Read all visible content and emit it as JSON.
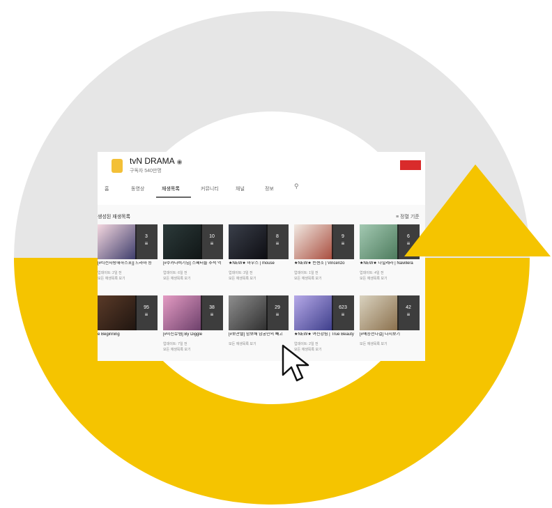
{
  "channel": {
    "name": "tvN DRAMA",
    "verified_icon": "verified-icon",
    "subscribers": "구독자 540만명"
  },
  "tabs": [
    "홈",
    "동영상",
    "재생목록",
    "커뮤니티",
    "채널",
    "정보"
  ],
  "active_tab": "재생목록",
  "section": {
    "title": "생성된 재생목록",
    "sort_label": "정렬 기준"
  },
  "playlists_row1": [
    {
      "title": "[#티전자랑해하스포]] 드라마 등",
      "count": "3",
      "meta": "업데이트: 2일 전",
      "link": "모든 재생목록 보기"
    },
    {
      "title": "[#주카다비기님] 스페터를 추적 역",
      "count": "10",
      "meta": "업데이트: 6일 전",
      "link": "모든 재생목록 보기"
    },
    {
      "title": "★NEW★ 마우스 | mouse",
      "count": "8",
      "meta": "업데이트: 3일 전",
      "link": "모든 재생목록 보기"
    },
    {
      "title": "★NEW★ 빈센조 | Vincenzo",
      "count": "9",
      "meta": "업데이트: 1일 전",
      "link": "모든 재생목록 보기"
    },
    {
      "title": "★NEW★ 나빌레라 | Navillera",
      "count": "6",
      "meta": "업데이트: 4일 전",
      "link": "모든 재생목록 보기"
    }
  ],
  "playlists_row2": [
    {
      "title": "e Beginning",
      "count": "95",
      "meta": "",
      "link": ""
    },
    {
      "title": "[#미신뮤템] By Diggle",
      "count": "38",
      "meta": "업데이트: 7일 전",
      "link": "모든 재생목록 보기"
    },
    {
      "title": "[#보관빨] 밤보배 남궁민의 빼고",
      "count": "29",
      "meta": "모든 재생목록 보기",
      "link": ""
    },
    {
      "title": "★NEW★ 여신강림 | True Beauty",
      "count": "623",
      "meta": "업데이트: 2일 전",
      "link": "모든 재생목록 보기"
    },
    {
      "title": "[#예능선나결] 다시보기",
      "count": "42",
      "meta": "모든 재생목록 보기",
      "link": ""
    }
  ],
  "colors": {
    "ring_gray": "#e6e6e6",
    "ring_yellow": "#f5c400",
    "youtube_red": "#d92b2b"
  },
  "icons": {
    "playlist": "playlist-icon",
    "cursor": "mouse-pointer-icon",
    "search": "search-icon",
    "sort": "sort-icon"
  }
}
